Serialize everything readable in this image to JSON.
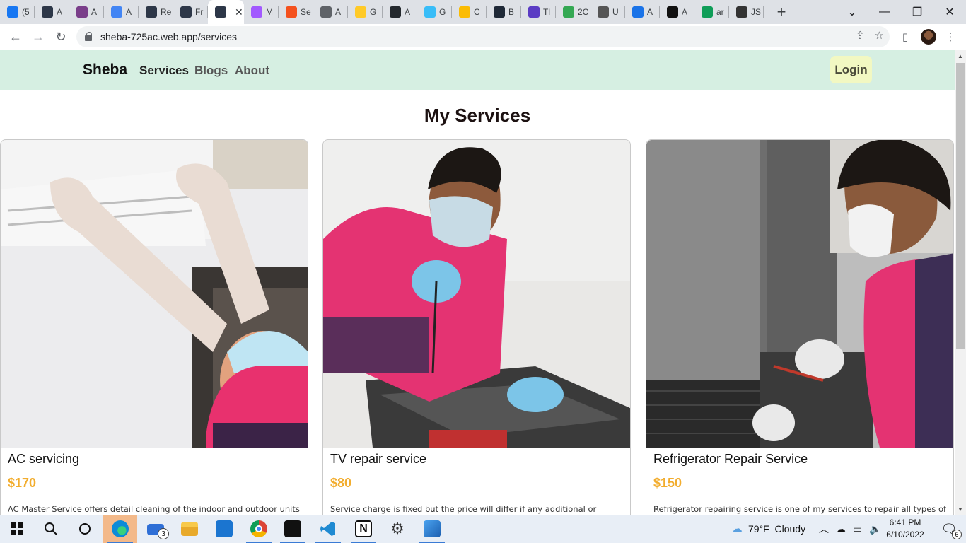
{
  "browser": {
    "tabs": [
      {
        "title": "(5",
        "icon": "facebook-icon",
        "color": "#1877f2"
      },
      {
        "title": "A",
        "icon": "react-icon",
        "color": "#2d3748"
      },
      {
        "title": "A",
        "icon": "profile-photo-icon",
        "color": "#7a3e8a"
      },
      {
        "title": "A",
        "icon": "google-docs-icon",
        "color": "#4285f4"
      },
      {
        "title": "Re",
        "icon": "react-icon",
        "color": "#2d3748"
      },
      {
        "title": "Fr",
        "icon": "react-icon",
        "color": "#2d3748"
      },
      {
        "title": "",
        "icon": "react-icon",
        "color": "#2d3748",
        "active": true
      },
      {
        "title": "M",
        "icon": "figma-icon",
        "color": "#a259ff"
      },
      {
        "title": "Se",
        "icon": "grammar-icon",
        "color": "#f4511e"
      },
      {
        "title": "A",
        "icon": "globe-icon",
        "color": "#5f6368"
      },
      {
        "title": "G",
        "icon": "firebase-icon",
        "color": "#ffca28"
      },
      {
        "title": "A",
        "icon": "github-icon",
        "color": "#24292e"
      },
      {
        "title": "G",
        "icon": "tailwind-icon",
        "color": "#38bdf8"
      },
      {
        "title": "C",
        "icon": "sun-icon",
        "color": "#fbbc04"
      },
      {
        "title": "B",
        "icon": "bootstrap-icon",
        "color": "#1f2937"
      },
      {
        "title": "Tl",
        "icon": "six-icon",
        "color": "#5b3cc4"
      },
      {
        "title": "2C",
        "icon": "calendar-icon",
        "color": "#34a853"
      },
      {
        "title": "U",
        "icon": "udemy-icon",
        "color": "#555"
      },
      {
        "title": "A",
        "icon": "imgbb-icon",
        "color": "#1a73e8"
      },
      {
        "title": "A",
        "icon": "app-icon",
        "color": "#111"
      },
      {
        "title": "ar",
        "icon": "google-drive-icon",
        "color": "#0f9d58"
      },
      {
        "title": "JS",
        "icon": "js-icon",
        "color": "#333"
      }
    ],
    "url": "sheba-725ac.web.app/services"
  },
  "site": {
    "brand": "Sheba",
    "nav": {
      "services": "Services",
      "blogs": "Blogs",
      "about": "About"
    },
    "login": "Login",
    "heading": "My Services"
  },
  "services": [
    {
      "title": "AC servicing",
      "price": "$170",
      "desc": "AC Master Service offers detail cleaning of the indoor and outdoor units"
    },
    {
      "title": "TV repair service",
      "price": "$80",
      "desc": "Service charge is fixed but the price will differ if any additional or"
    },
    {
      "title": "Refrigerator Repair Service",
      "price": "$150",
      "desc": "Refrigerator repairing service is one of my services to repair all types of"
    }
  ],
  "taskbar": {
    "weather": "79°F  Cloudy",
    "time": "6:41 PM",
    "date": "6/10/2022",
    "mail_badge": "3",
    "notification_badge": "6"
  },
  "colors": {
    "navbar_bg": "#d6efe2",
    "login_bg": "#f2f8c2",
    "price": "#f2ad2e"
  }
}
